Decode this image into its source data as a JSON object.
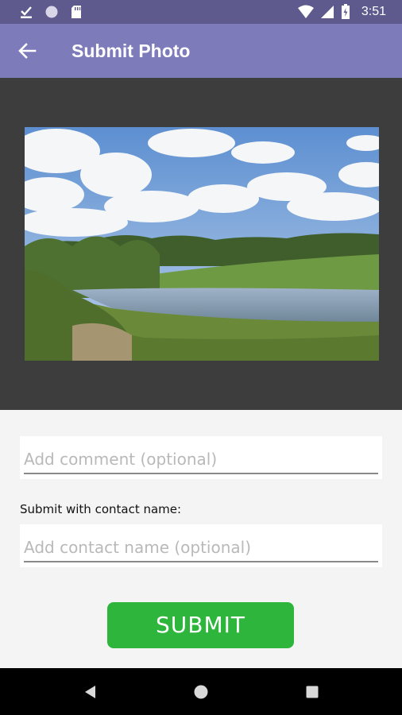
{
  "status_bar": {
    "time": "3:51",
    "icons": [
      "download-done-icon",
      "circle-icon",
      "sd-card-icon",
      "wifi-icon",
      "signal-icon",
      "battery-icon"
    ]
  },
  "app_bar": {
    "title": "Submit Photo",
    "back_icon": "arrow-back-icon"
  },
  "photo": {
    "description_icon": "landscape-photo"
  },
  "form": {
    "comment_placeholder": "Add comment (optional)",
    "comment_value": "",
    "contact_label": "Submit with contact name:",
    "contact_placeholder": "Add contact name (optional)",
    "contact_value": "",
    "submit_label": "SUBMIT"
  },
  "nav_bar": {
    "icons": [
      "back-triangle-icon",
      "home-circle-icon",
      "recents-square-icon"
    ]
  },
  "colors": {
    "status_bar": "#5e5a8e",
    "app_bar": "#7e7bbb",
    "preview_bg": "#3d3d3d",
    "submit": "#2db53c"
  }
}
